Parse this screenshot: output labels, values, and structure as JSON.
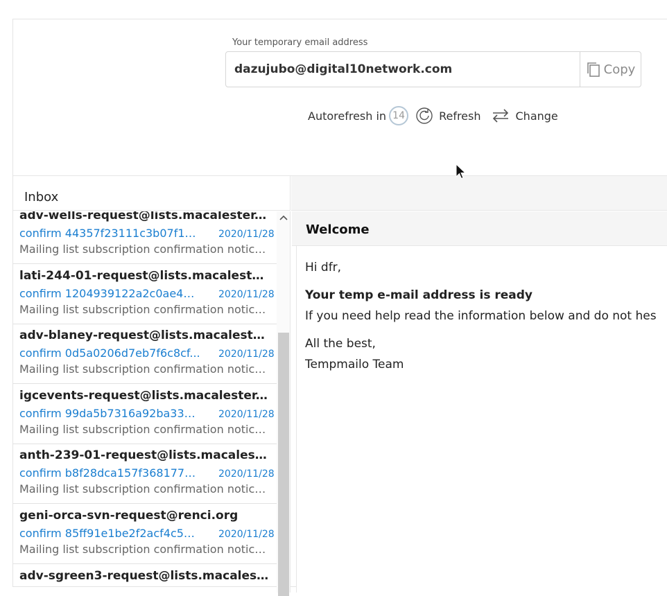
{
  "header": {
    "address_label": "Your temporary email address",
    "address_value": "dazujubo@digital10network.com",
    "copy_label": "Copy",
    "autorefresh_label": "Autorefresh in",
    "autorefresh_count": "14",
    "refresh_label": "Refresh",
    "change_label": "Change"
  },
  "inbox": {
    "title": "Inbox",
    "items": [
      {
        "from": "adv-wells-request@lists.macalester.edu",
        "subject": "confirm 44357f23111c3b07f124...",
        "date": "2020/11/28",
        "preview": "Mailing list subscription confirmation notice f..."
      },
      {
        "from": "lati-244-01-request@lists.macalester.e...",
        "subject": "confirm 1204939122a2c0ae4e8...",
        "date": "2020/11/28",
        "preview": "Mailing list subscription confirmation notice f..."
      },
      {
        "from": "adv-blaney-request@lists.macalester....",
        "subject": "confirm 0d5a0206d7eb7f6c8cf...",
        "date": "2020/11/28",
        "preview": "Mailing list subscription confirmation notice f..."
      },
      {
        "from": "igcevents-request@lists.macalester.edu",
        "subject": "confirm 99da5b7316a92ba3315...",
        "date": "2020/11/28",
        "preview": "Mailing list subscription confirmation notice f..."
      },
      {
        "from": "anth-239-01-request@lists.macalester....",
        "subject": "confirm b8f28dca157f3681772d...",
        "date": "2020/11/28",
        "preview": "Mailing list subscription confirmation notice f..."
      },
      {
        "from": "geni-orca-svn-request@renci.org",
        "subject": "confirm 85ff91e1be2f2acf4c5e3...",
        "date": "2020/11/28",
        "preview": "Mailing list subscription confirmation notice f..."
      },
      {
        "from": "adv-sgreen3-request@lists.macalester....",
        "subject": "",
        "date": "",
        "preview": ""
      }
    ]
  },
  "message": {
    "title": "Welcome",
    "greeting": "Hi dfr,",
    "headline": "Your temp e-mail address is ready",
    "body": "If you need help read the information below and do not hes",
    "signoff": "All the best,",
    "team": "Tempmailo Team"
  },
  "icons": {
    "copy": "copy-icon",
    "refresh": "refresh-icon",
    "change": "swap-icon",
    "scroll_up": "chevron-up-icon",
    "cursor": "mouse-pointer-icon"
  },
  "colors": {
    "link": "#1a7ed0",
    "thumb": "#cccccc"
  }
}
